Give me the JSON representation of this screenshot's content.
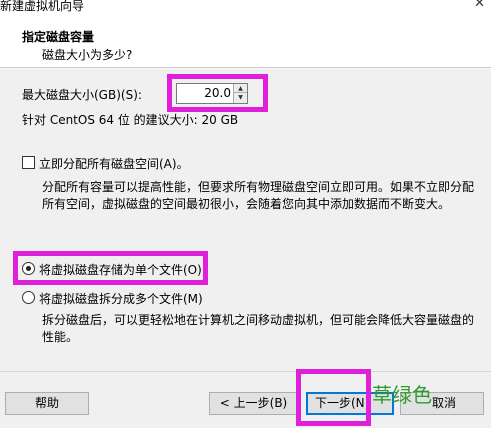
{
  "window": {
    "title": "新建虚拟机向导",
    "close_glyph": "✕"
  },
  "header": {
    "title": "指定磁盘容量",
    "subtitle": "磁盘大小为多少?"
  },
  "disk": {
    "max_label": "最大磁盘大小(GB)(S):",
    "value": "20.0",
    "recommended": "针对 CentOS 64 位 的建议大小: 20 GB"
  },
  "allocate": {
    "label": "立即分配所有磁盘空间(A)。",
    "checked": false,
    "description_lines": [
      "分配所有容量可以提高性能，但要求所有物理磁盘空间立即可用。如果不立即分配",
      "所有空间，虚拟磁盘的空间最初很小，会随着您向其中添加数据而不断变大。"
    ]
  },
  "storage": {
    "single_label": "将虚拟磁盘存储为单个文件(O)",
    "multi_label": "将虚拟磁盘拆分成多个文件(M)",
    "selected": "single",
    "multi_description_lines": [
      "拆分磁盘后，可以更轻松地在计算机之间移动虚拟机，但可能会降低大容量磁盘的",
      "性能。"
    ]
  },
  "footer": {
    "help_label": "帮助",
    "back_label": "< 上一步(B)",
    "next_label": "下一步(N)",
    "cancel_label": "取消"
  },
  "watermark": "草绿色",
  "highlight_color": "#e020d8"
}
